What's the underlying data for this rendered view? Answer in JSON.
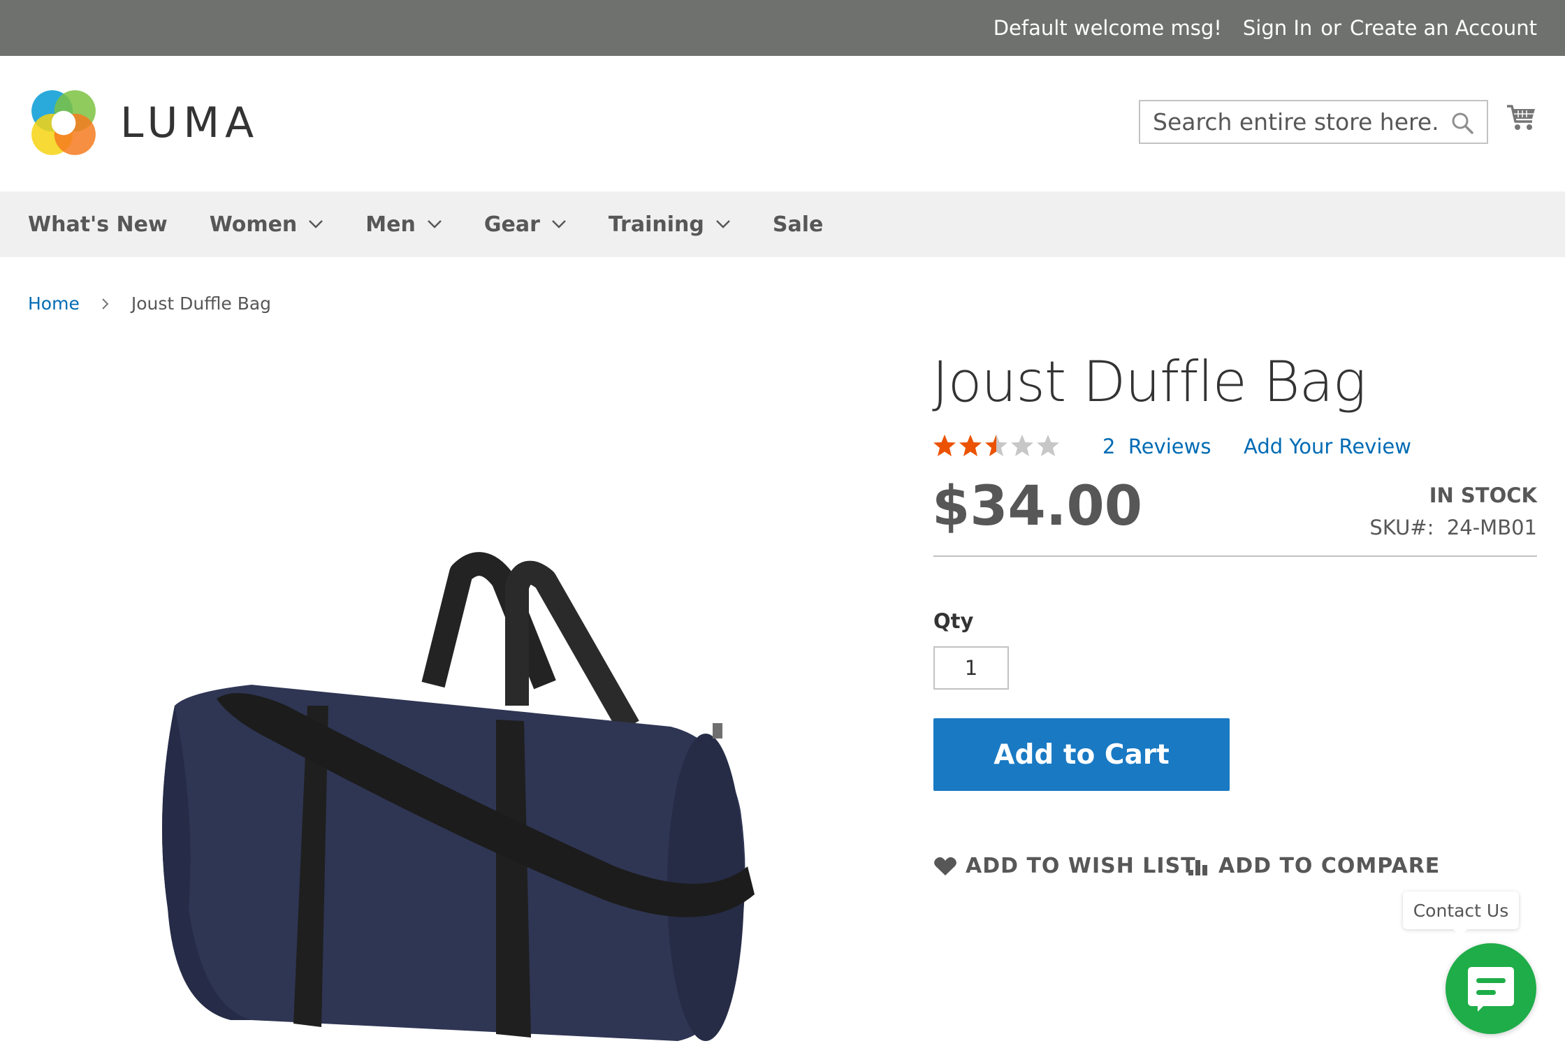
{
  "top_panel": {
    "welcome": "Default welcome msg!",
    "sign_in": "Sign In",
    "or": "or",
    "create_account": "Create an Account"
  },
  "header": {
    "logo_text": "LUMA",
    "search_placeholder": "Search entire store here...",
    "search_icon": "search-icon",
    "cart_icon": "cart-icon"
  },
  "nav": {
    "items": [
      {
        "label": "What's New",
        "has_dropdown": false
      },
      {
        "label": "Women",
        "has_dropdown": true
      },
      {
        "label": "Men",
        "has_dropdown": true
      },
      {
        "label": "Gear",
        "has_dropdown": true
      },
      {
        "label": "Training",
        "has_dropdown": true
      },
      {
        "label": "Sale",
        "has_dropdown": false
      }
    ]
  },
  "breadcrumb": {
    "home": "Home",
    "current": "Joust Duffle Bag"
  },
  "product": {
    "title": "Joust Duffle Bag",
    "rating": 2.5,
    "rating_max": 5,
    "reviews_count": "2",
    "reviews_label": "Reviews",
    "add_review": "Add Your Review",
    "price": "$34.00",
    "stock": "In stock",
    "sku_label": "SKU#:",
    "sku_value": "24-MB01",
    "qty_label": "Qty",
    "qty_value": "1",
    "add_to_cart": "Add to Cart",
    "wish_list": "Add to Wish List",
    "compare": "Add to Compare"
  },
  "colors": {
    "top_panel_bg": "#6e716e",
    "link": "#006bb4",
    "primary_button": "#1979c3",
    "star_filled": "#eb5202",
    "star_empty": "#c7c7c7",
    "chat_green": "#1ead48"
  },
  "contact": {
    "tooltip": "Contact Us",
    "chat_icon": "chat-icon"
  }
}
